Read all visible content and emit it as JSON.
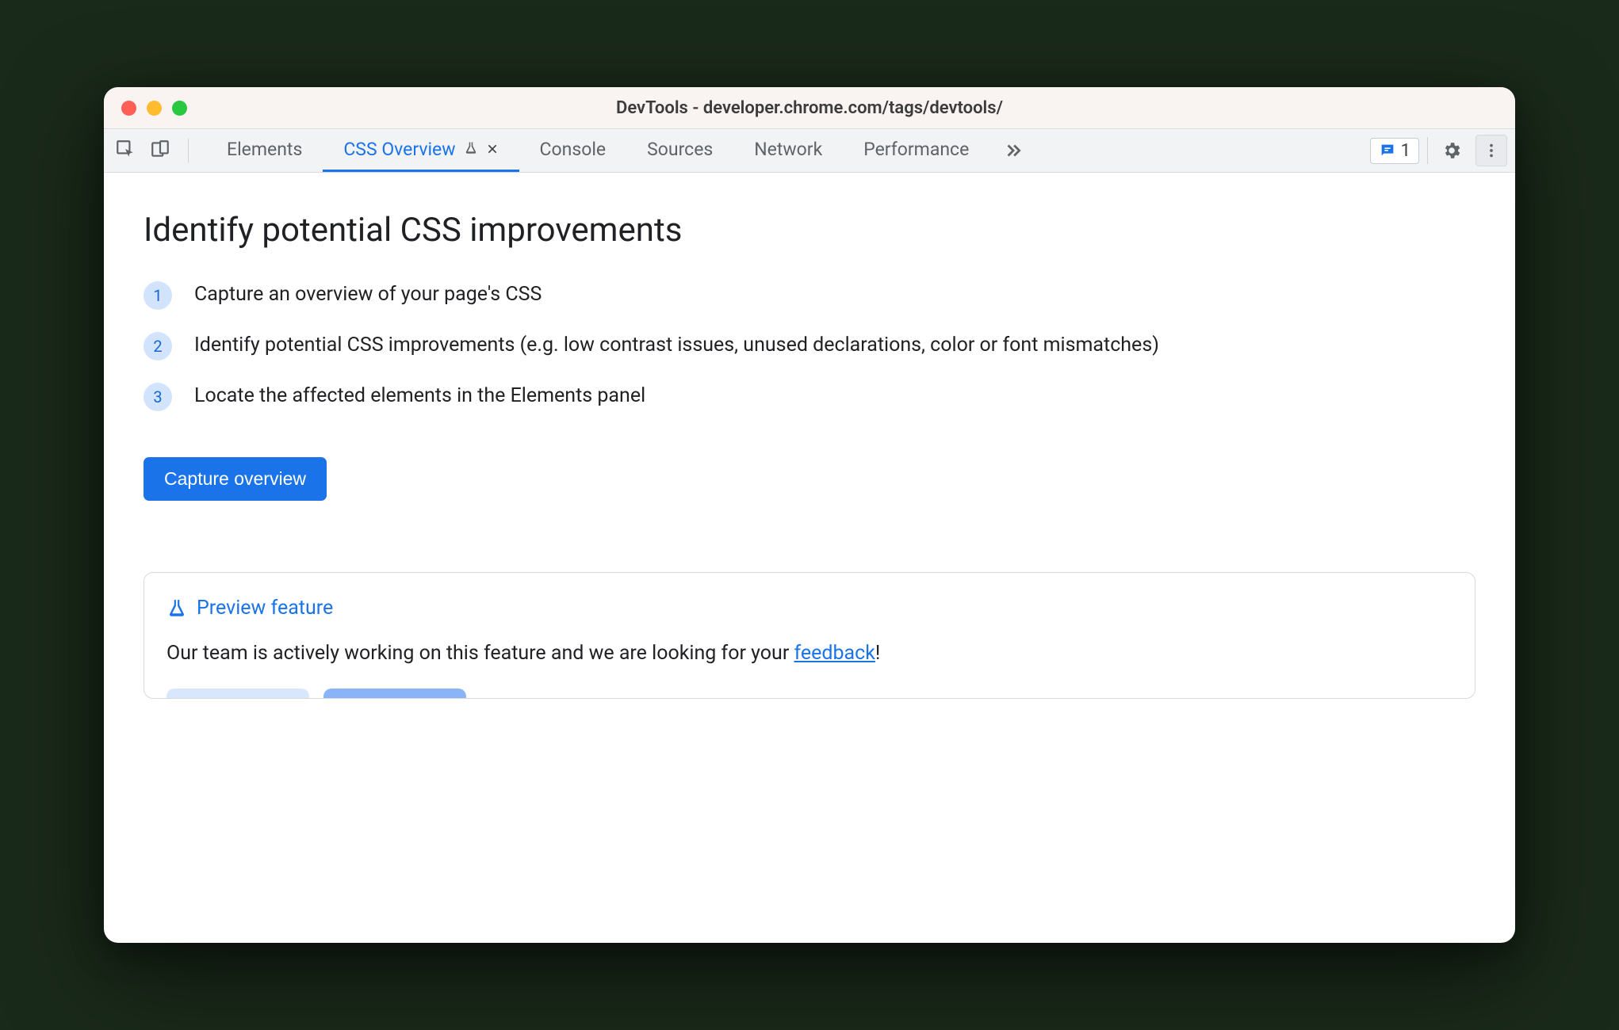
{
  "window": {
    "title": "DevTools - developer.chrome.com/tags/devtools/"
  },
  "tabs": {
    "items": [
      {
        "label": "Elements"
      },
      {
        "label": "CSS Overview",
        "active": true,
        "experimental": true,
        "closable": true
      },
      {
        "label": "Console"
      },
      {
        "label": "Sources"
      },
      {
        "label": "Network"
      },
      {
        "label": "Performance"
      }
    ]
  },
  "issues": {
    "count": "1"
  },
  "main": {
    "heading": "Identify potential CSS improvements",
    "steps": [
      {
        "n": "1",
        "text": "Capture an overview of your page's CSS"
      },
      {
        "n": "2",
        "text": "Identify potential CSS improvements (e.g. low contrast issues, unused declarations, color or font mismatches)"
      },
      {
        "n": "3",
        "text": "Locate the affected elements in the Elements panel"
      }
    ],
    "cta_label": "Capture overview"
  },
  "preview": {
    "title": "Preview feature",
    "body_pre": "Our team is actively working on this feature and we are looking for your ",
    "link_text": "feedback",
    "body_post": "!"
  }
}
